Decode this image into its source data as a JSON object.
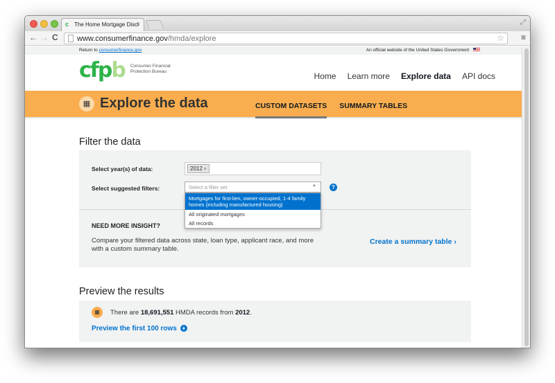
{
  "browser": {
    "tab_title": "The Home Mortgage Discl",
    "tab_favicon": "c",
    "tab_close": "×",
    "url_host": "www.consumerfinance.gov",
    "url_path": "/hmda/explore",
    "icons": {
      "back": "←",
      "forward": "→",
      "reload": "C",
      "star": "☆",
      "menu": "≡",
      "fullscreen": "⤢"
    }
  },
  "govbar": {
    "return_prefix": "Return to ",
    "return_link": "consumerfinance.gov",
    "official_text": "An official website of the United States Government"
  },
  "header": {
    "logo_letters": [
      "c",
      "f",
      "p",
      "b"
    ],
    "logo_line1": "Consumer Financial",
    "logo_line2": "Protection Bureau",
    "nav": [
      {
        "label": "Home",
        "active": false
      },
      {
        "label": "Learn more",
        "active": false
      },
      {
        "label": "Explore data",
        "active": true
      },
      {
        "label": "API docs",
        "active": false
      }
    ]
  },
  "banner": {
    "icon": "▦",
    "title": "Explore the data",
    "tabs": [
      {
        "label": "CUSTOM DATASETS",
        "active": true
      },
      {
        "label": "SUMMARY TABLES",
        "active": false
      }
    ],
    "color": "#f9ad4e"
  },
  "filter": {
    "title": "Filter the data",
    "year_label": "Select year(s) of data:",
    "year_chip": "2012",
    "chip_remove": "×",
    "suggested_label": "Select suggested filters:",
    "select_placeholder": "Select a filter set",
    "select_arrow": "▲",
    "help": "?",
    "options": [
      {
        "label": "Mortgages for first-lien, owner-occupied, 1-4 family homes (including manufactured housing)",
        "highlighted": true
      },
      {
        "label": "All originated mortgages",
        "highlighted": false
      },
      {
        "label": "All records",
        "highlighted": false
      }
    ],
    "insight_title": "NEED MORE INSIGHT?",
    "insight_body": "Compare your filtered data across state, loan type, applicant race, and more with a custom summary table.",
    "summary_link": "Create a summary table ›"
  },
  "preview": {
    "title": "Preview the results",
    "icon": "▦",
    "text_prefix": "There are ",
    "record_count": "18,691,551",
    "text_mid": " HMDA records from ",
    "year": "2012",
    "text_suffix": ".",
    "link": "Preview the first 100 rows",
    "link_icon": "+"
  },
  "colors": {
    "accent_blue": "#0072ce",
    "cfpb_green": "#2cb34a",
    "panel_gray": "#f1f2f2"
  }
}
